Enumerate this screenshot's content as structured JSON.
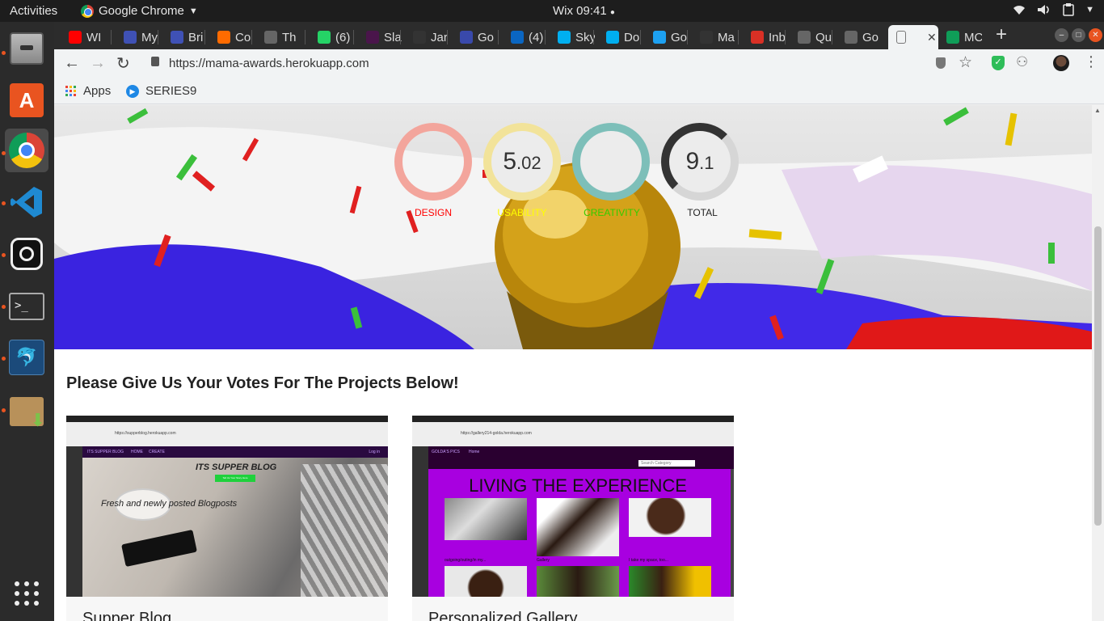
{
  "topbar": {
    "activities": "Activities",
    "app_name": "Google Chrome",
    "clock": "Wix 09:41"
  },
  "dock": {
    "items": [
      "files",
      "software",
      "chrome",
      "vscode",
      "camera",
      "terminal",
      "mysql",
      "archive",
      "apps-grid"
    ]
  },
  "tabs": [
    {
      "label": "WI",
      "color": "#ff0000"
    },
    {
      "label": "My",
      "color": "#3f51b5"
    },
    {
      "label": "Bri",
      "color": "#3f51b5"
    },
    {
      "label": "Co",
      "color": "#ff6b00"
    },
    {
      "label": "Th",
      "color": "#666666"
    },
    {
      "label": "(6)",
      "color": "#25d366"
    },
    {
      "label": "Sla",
      "color": "#4a154b"
    },
    {
      "label": "Jar",
      "color": "#333333"
    },
    {
      "label": "Go",
      "color": "#3949ab"
    },
    {
      "label": "(4)",
      "color": "#0a66c2"
    },
    {
      "label": "Sky",
      "color": "#00aff0"
    },
    {
      "label": "Do",
      "color": "#00aff0"
    },
    {
      "label": "Go",
      "color": "#1da1f2"
    },
    {
      "label": "Ma",
      "color": "#333333"
    },
    {
      "label": "Inb",
      "color": "#d93025"
    },
    {
      "label": "Qu",
      "color": "#666666"
    },
    {
      "label": "Go",
      "color": "#666666"
    },
    {
      "label": "",
      "color": "#888888"
    },
    {
      "label": "MC",
      "color": "#0f9d58"
    }
  ],
  "address": {
    "url": "https://mama-awards.herokuapp.com"
  },
  "bookmarks": {
    "apps": "Apps",
    "series9": "SERIES9"
  },
  "scores": {
    "design": {
      "label": "DESIGN",
      "value": "",
      "color": "#ff0000",
      "ring": "#f3a59c"
    },
    "usability": {
      "label": "USABILITY",
      "value_int": "5",
      "value_dec": ".02",
      "color": "#ffff00",
      "ring": "#f2e39a"
    },
    "creativity": {
      "label": "CREATIVITY",
      "value": "",
      "color": "#33cc00",
      "ring": "#7dbfb9"
    },
    "total": {
      "label": "TOTAL",
      "value_int": "9",
      "value_dec": ".1",
      "color": "#222222",
      "ring": "#d6d6d6"
    }
  },
  "content": {
    "heading": "Please Give Us Your Votes For The Projects Below!"
  },
  "projects": [
    {
      "name": "Supper Blog",
      "site_title": "ITS SUPPER BLOG",
      "site_button": "Tell Us Your Story Here",
      "site_tagline": "Fresh and newly posted Blogposts",
      "site_url": "https://supperblog.herokuapp.com",
      "nav": [
        "ITS SUPPER BLOG",
        "HOME",
        "CREATE"
      ],
      "login": "Log in"
    },
    {
      "name": "Personalized Gallery",
      "site_title": "LIVING THE EXPERIENCE",
      "site_brand": "GOLDA'S PICS",
      "site_nav": "Home",
      "site_search": "Search Category",
      "site_url": "https://gallery214-golda.herokuapp.com",
      "captions": [
        "outgoing/outing/in my...",
        "Gallery",
        "I take my space, too..."
      ]
    }
  ]
}
